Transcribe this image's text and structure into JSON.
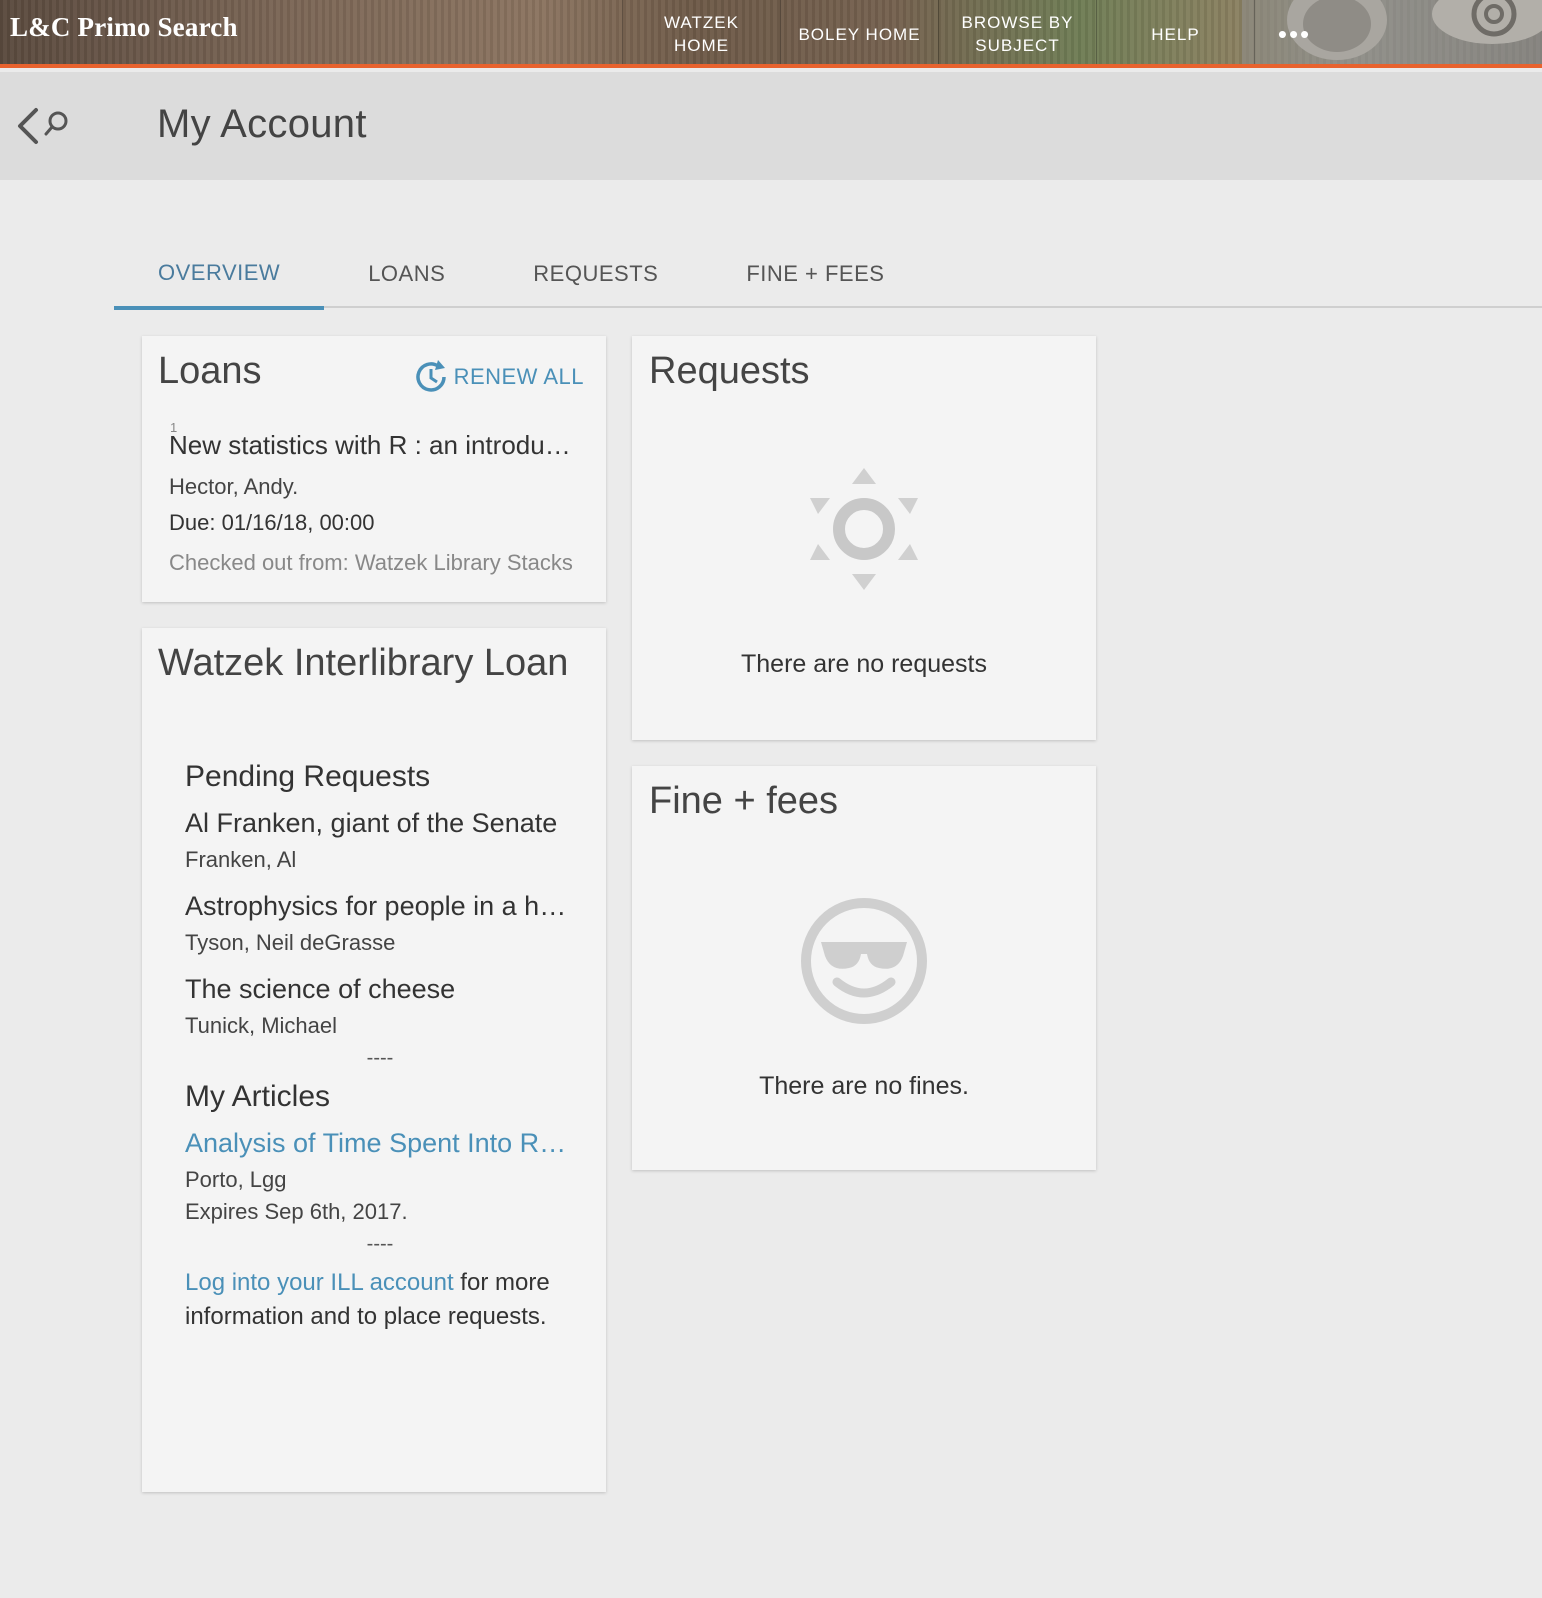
{
  "header": {
    "logo": "L&C Primo Search",
    "nav": [
      {
        "label_line1": "WATZEK",
        "label_line2": "HOME"
      },
      {
        "label_line1": "BOLEY HOME",
        "label_line2": ""
      },
      {
        "label_line1": "BROWSE BY",
        "label_line2": "SUBJECT"
      },
      {
        "label_line1": "HELP",
        "label_line2": ""
      }
    ],
    "more": "•••",
    "accent_color": "#e8622e"
  },
  "page": {
    "title": "My Account"
  },
  "tabs": [
    {
      "label": "OVERVIEW",
      "active": true
    },
    {
      "label": "LOANS",
      "active": false
    },
    {
      "label": "REQUESTS",
      "active": false
    },
    {
      "label": "FINE + FEES",
      "active": false
    }
  ],
  "loans": {
    "title": "Loans",
    "renew_all": "RENEW ALL",
    "item": {
      "index": "1",
      "title": "New statistics with R : an introduction for biologists",
      "author": "Hector, Andy.",
      "due": "Due: 01/16/18, 00:00",
      "from": "Checked out from: Watzek Library Stacks"
    }
  },
  "ill": {
    "title": "Watzek Interlibrary Loan",
    "pending_heading": "Pending Requests",
    "pending": [
      {
        "title": "Al Franken, giant of the Senate",
        "author": "Franken, Al"
      },
      {
        "title": "Astrophysics for people in a hurry",
        "author": "Tyson, Neil deGrasse"
      },
      {
        "title": "The science of cheese",
        "author": "Tunick, Michael"
      }
    ],
    "divider": "----",
    "articles_heading": "My Articles",
    "article": {
      "title": "Analysis of Time Spent Into Research",
      "author": "Porto, Lgg",
      "expires": "Expires Sep 6th, 2017."
    },
    "divider2": "----",
    "login_link": "Log into your ILL account",
    "login_rest": " for more information and to place requests."
  },
  "requests": {
    "title": "Requests",
    "empty": "There are no requests",
    "icon": "sun-icon"
  },
  "fines": {
    "title": "Fine + fees",
    "empty": "There are no fines.",
    "icon": "cool-face-icon"
  }
}
